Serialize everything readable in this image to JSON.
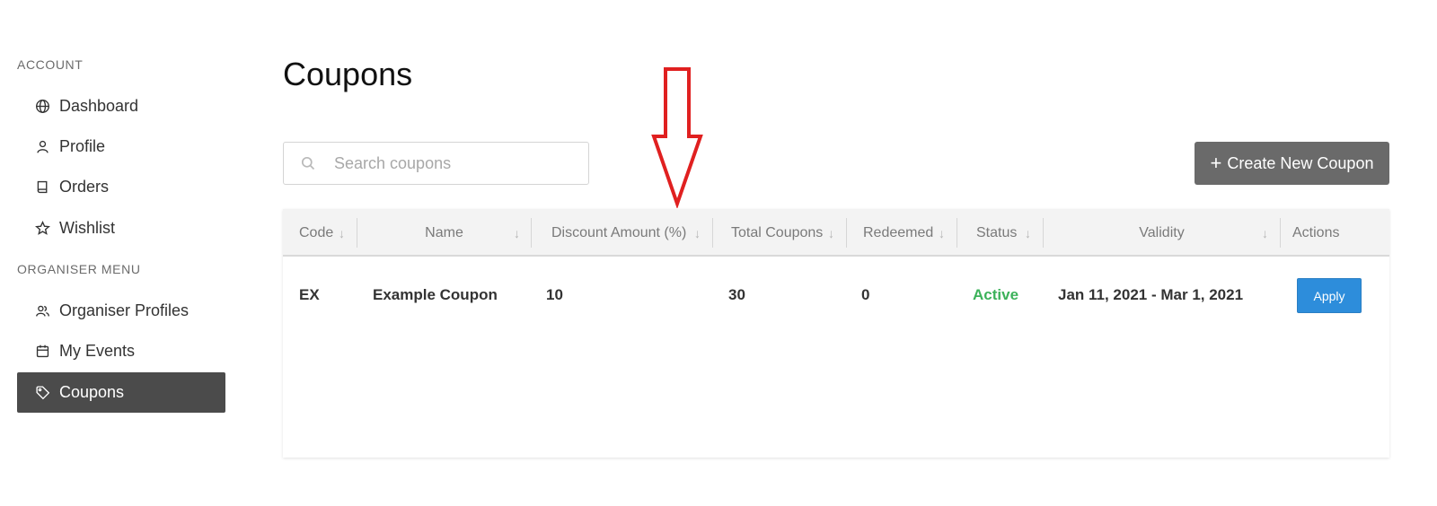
{
  "sidebar": {
    "account_heading": "ACCOUNT",
    "organiser_heading": "ORGANISER MENU",
    "account_items": [
      {
        "label": "Dashboard",
        "icon": "globe-icon"
      },
      {
        "label": "Profile",
        "icon": "user-icon"
      },
      {
        "label": "Orders",
        "icon": "book-icon"
      },
      {
        "label": "Wishlist",
        "icon": "star-icon"
      }
    ],
    "organiser_items": [
      {
        "label": "Organiser Profiles",
        "icon": "users-icon"
      },
      {
        "label": "My Events",
        "icon": "calendar-icon"
      },
      {
        "label": "Coupons",
        "icon": "tag-icon",
        "active": true
      }
    ]
  },
  "main": {
    "title": "Coupons",
    "search": {
      "placeholder": "Search coupons",
      "value": ""
    },
    "create_button": {
      "plus": "+",
      "label": "Create New Coupon"
    }
  },
  "table": {
    "columns": [
      "Code",
      "Name",
      "Discount Amount (%)",
      "Total Coupons",
      "Redeemed",
      "Status",
      "Validity",
      "Actions"
    ],
    "sort_glyph": "↓",
    "rows": [
      {
        "code": "EX",
        "name": "Example Coupon",
        "discount": "10",
        "total": "30",
        "redeemed": "0",
        "status": "Active",
        "validity": "Jan 11, 2021 - Mar 1, 2021",
        "action_label": "Apply"
      }
    ]
  },
  "colors": {
    "active_nav_bg": "#4b4b4b",
    "create_button_bg": "#6a6a6a",
    "apply_button_bg": "#2d8ddb",
    "status_active": "#3cb25a",
    "annotation_arrow": "#e02020"
  }
}
